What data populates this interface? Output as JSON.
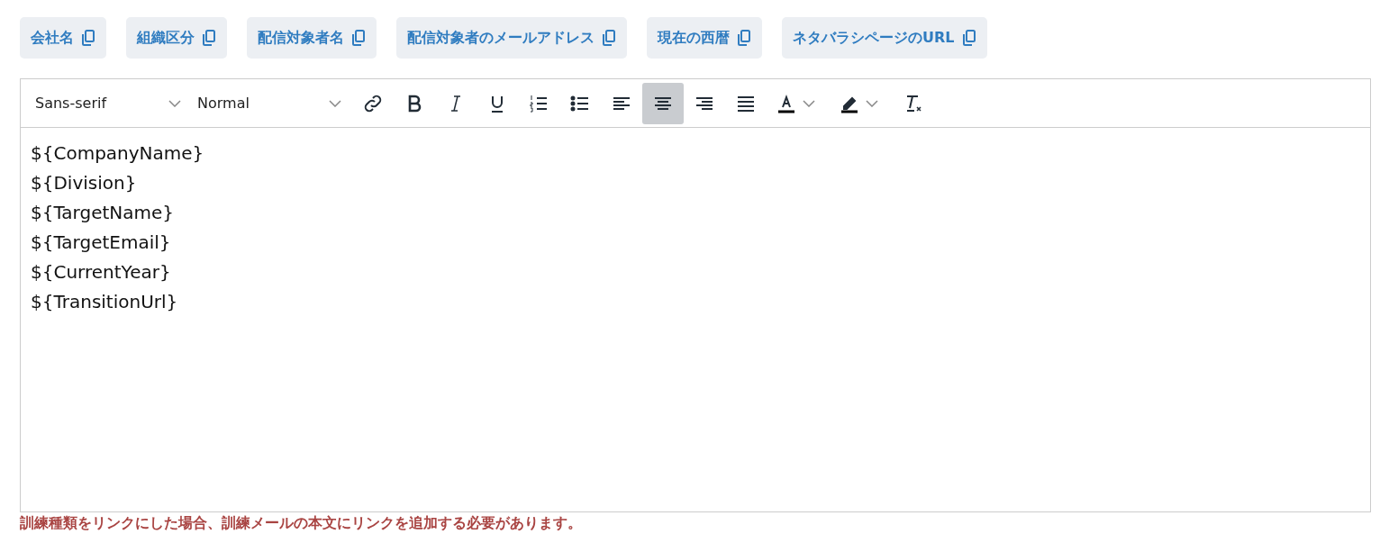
{
  "variable_buttons": [
    {
      "label": "会社名"
    },
    {
      "label": "組織区分"
    },
    {
      "label": "配信対象者名"
    },
    {
      "label": "配信対象者のメールアドレス"
    },
    {
      "label": "現在の西暦"
    },
    {
      "label": "ネタバラシページのURL"
    }
  ],
  "toolbar": {
    "font": "Sans-serif",
    "size": "Normal",
    "tools": [
      {
        "kind": "link",
        "selected": false
      },
      {
        "kind": "bold",
        "selected": false
      },
      {
        "kind": "italic",
        "selected": false
      },
      {
        "kind": "underline",
        "selected": false
      },
      {
        "kind": "ordered-list",
        "selected": false
      },
      {
        "kind": "bullet-list",
        "selected": false
      },
      {
        "kind": "align-left",
        "selected": false
      },
      {
        "kind": "align-center",
        "selected": true
      },
      {
        "kind": "align-right",
        "selected": false
      },
      {
        "kind": "justify",
        "selected": false
      },
      {
        "kind": "text-color",
        "selected": false
      },
      {
        "kind": "highlight",
        "selected": false
      },
      {
        "kind": "clear-format",
        "selected": false
      }
    ]
  },
  "editor_lines": [
    "${CompanyName}",
    "${Division}",
    "${TargetName}",
    "${TargetEmail}",
    "${CurrentYear}",
    "${TransitionUrl}"
  ],
  "warning": "訓練種類をリンクにした場合、訓練メールの本文にリンクを追加する必要があります。"
}
